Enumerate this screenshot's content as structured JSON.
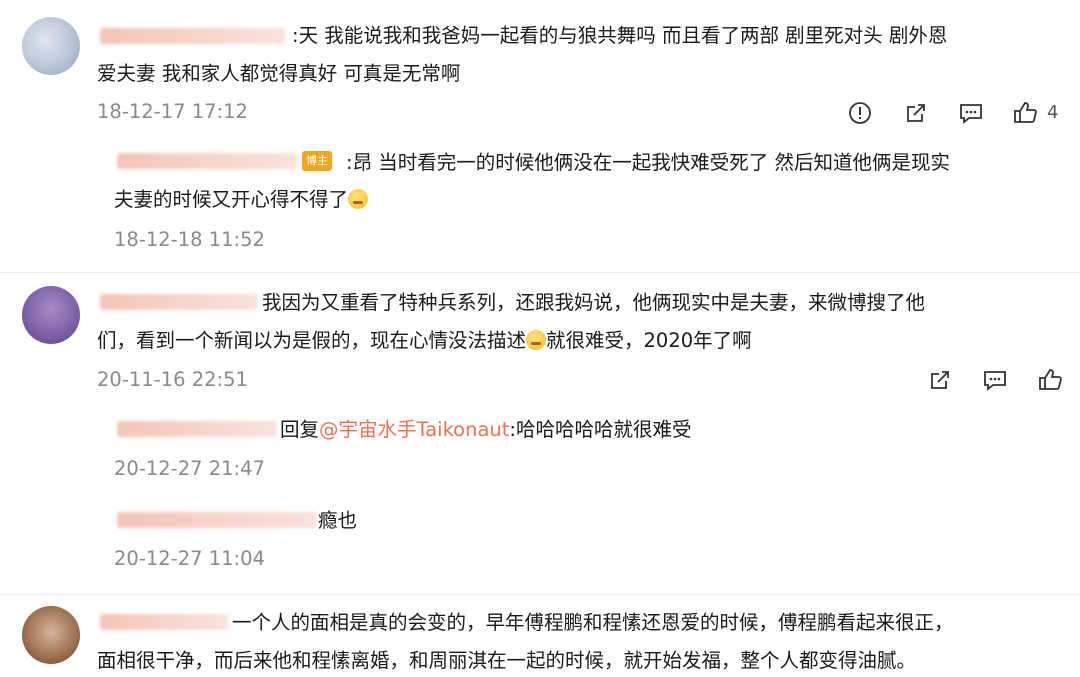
{
  "comments": [
    {
      "text_lines": [
        ":天 我能说我和我爸妈一起看的与狼共舞吗 而且看了两部 剧里死对头 剧外恩",
        "爱夫妻 我和家人都觉得真好 可真是无常啊"
      ],
      "time": "18-12-17 17:12",
      "like_count": "4",
      "reply": {
        "badge": "博主",
        "text_lines": [
          ":昂 当时看完一的时候他俩没在一起我快难受死了 然后知道他俩是现实",
          "夫妻的时候又开心得不得了"
        ],
        "time": "18-12-18 11:52"
      }
    },
    {
      "text_lines": [
        "我因为又重看了特种兵系列，还跟我妈说，他俩现实中是夫妻，来微博搜了他",
        "们，看到一个新闻以为是假的，现在心情没法描述",
        "就很难受，2020年了啊"
      ],
      "time": "20-11-16 22:51",
      "replies": [
        {
          "prefix": "回复",
          "mention": "@宇宙水手Taikonaut",
          "text": ":哈哈哈哈哈就很难受",
          "time": "20-12-27 21:47"
        },
        {
          "text": "瘾也",
          "time": "20-12-27 11:04"
        }
      ]
    },
    {
      "text_lines": [
        "一个人的面相是真的会变的，早年傅程鹏和程愫还恩爱的时候，傅程鹏看起来很正，",
        "面相很干净，而后来他和程愫离婚，和周丽淇在一起的时候，就开始发福，整个人都变得油腻。"
      ]
    }
  ],
  "icons": [
    "report-icon",
    "share-icon",
    "comment-icon",
    "like-icon"
  ],
  "colors": {
    "mention": "#eb7350",
    "timestamp": "#8a8a8a",
    "badge": "#f4a623"
  }
}
